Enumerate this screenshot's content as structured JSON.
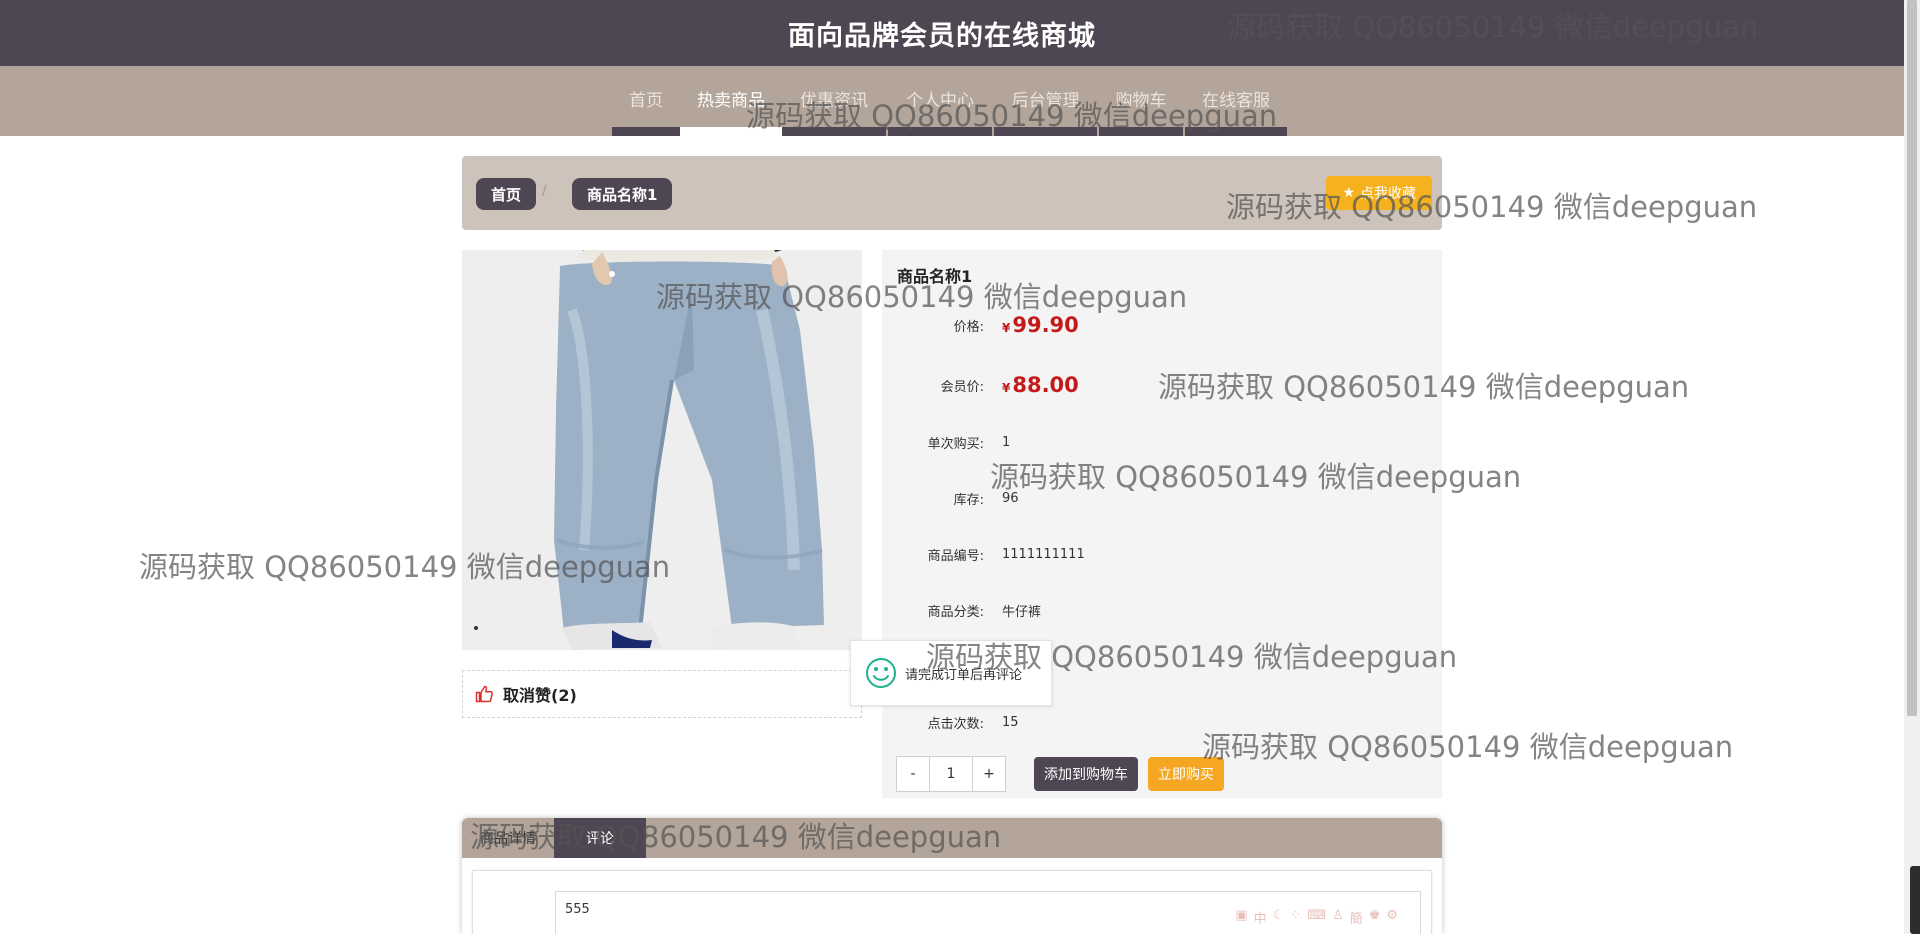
{
  "header": {
    "title": "面向品牌会员的在线商城"
  },
  "nav": {
    "items": [
      {
        "label": "首页"
      },
      {
        "label": "热卖商品"
      },
      {
        "label": "优惠资讯"
      },
      {
        "label": "个人中心"
      },
      {
        "label": "后台管理"
      },
      {
        "label": "购物车"
      },
      {
        "label": "在线客服"
      }
    ],
    "active": "热卖商品"
  },
  "breadcrumb": {
    "home": "首页",
    "separator": "/",
    "current": "商品名称1"
  },
  "favorite_button": {
    "label": "点我收藏",
    "icon": "star-icon"
  },
  "product": {
    "name": "商品名称1",
    "currency": "¥",
    "price_label": "价格:",
    "price": "99.90",
    "member_price_label": "会员价:",
    "member_price": "88.00",
    "single_buy_label": "单次购买:",
    "single_buy": "1",
    "stock_label": "库存:",
    "stock": "96",
    "code_label": "商品编号:",
    "code": "1111111111",
    "category_label": "商品分类:",
    "category": "牛仔裤",
    "clicks_label": "点击次数:",
    "clicks": "15"
  },
  "like": {
    "label": "取消赞(2)",
    "icon": "thumbs-up-icon"
  },
  "quantity": {
    "minus": "-",
    "value": "1",
    "plus": "+"
  },
  "actions": {
    "add_to_cart": "添加到购物车",
    "buy_now": "立即购买"
  },
  "toast": {
    "message": "请完成订单后再评论",
    "icon": "smile-icon"
  },
  "tabs": {
    "items": [
      "商品详情",
      "评论"
    ],
    "active": "评论"
  },
  "comment_editor": {
    "value": "555"
  },
  "watermark": {
    "text": "源码获取 QQ86050149 微信deepguan"
  },
  "colors": {
    "header": "#4e4652",
    "nav": "#b4a59a",
    "breadcrumb_bg": "#cec3ba",
    "price": "#c41a1a",
    "accent_orange": "#f5a623"
  }
}
